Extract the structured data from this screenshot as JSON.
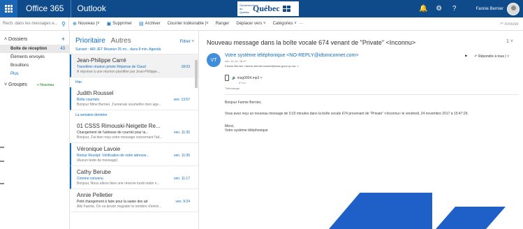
{
  "topbar": {
    "brand": "Office 365",
    "app": "Outlook",
    "gov_prefix": "Gouvernement du Québec",
    "gov_name": "Québec",
    "user_name": "Fannie Bernier"
  },
  "toolbar": {
    "search_placeholder": "Rech. dans les messages e...",
    "new": "Nouveau",
    "delete": "Supprimer",
    "archive": "Archiver",
    "junk": "Courrier indésirable",
    "sweep": "Ranger",
    "move": "Déplacer vers",
    "categories": "Catégories",
    "undo": "Annuler"
  },
  "folders": {
    "header": "Dossiers",
    "items": [
      {
        "label": "Boîte de réception",
        "count": "43"
      },
      {
        "label": "Éléments envoyés",
        "count": ""
      },
      {
        "label": "Brouillons",
        "count": ""
      },
      {
        "label": "Plus",
        "count": ""
      }
    ],
    "groups": "Groupes",
    "groups_new": "+ Nouveau"
  },
  "list": {
    "tab_focused": "Prioritaire",
    "tab_other": "Autres",
    "filter": "Filtrer",
    "tab_message": "Suivant : AIR JET Réunion 25 mi... dans 8 min. Agenda",
    "sections": {
      "yesterday": "Hier",
      "last_week": "La semaine dernière"
    },
    "messages": [
      {
        "sender": "Jean-Philippe Carré",
        "subject": "Transférer réunion privée Réponse de Claud",
        "time": "18:03",
        "preview": "À réponse à une réunion planifiée par Jean-Philippe..."
      },
      {
        "sender": "Judith Roussel",
        "subject": "Boîte courriels",
        "time": "ven. 13:57",
        "preview": "Bonjour Mme Bernier, J'annerais soumettre mon age..."
      },
      {
        "sender": "01 CSSS Rimouski-Neigette Re...",
        "subject": "Changement de l'adresse de courriel pour la...",
        "time": "ven. 11:35",
        "preview": "Bonjour, J'ai bien reçu votre message concernant l'ad..."
      },
      {
        "sender": "Véronique Lavoie",
        "subject": "Retour Receipt: Vérification de votre adresse...",
        "time": "ven. 11:35",
        "preview": "(Aucun texte de message)"
      },
      {
        "sender": "Cathy Berube",
        "subject": "Comme convenu",
        "time": "ven. 11:17",
        "preview": "Bonjour, Nous allons faire une réserve lundi matin s..."
      },
      {
        "sender": "Annie Pelletier",
        "subject": "Petit changement à faire pour la saisie des ad",
        "time": "ven. 9:24",
        "preview": "Allo Fannie, On va devoir réajuster le nombre d'entré..."
      }
    ]
  },
  "reading": {
    "title": "Nouveau message dans la boîte vocale 674 venant de \"Private\" <Inconnu>",
    "title_ctrl": "1",
    "avatar": "VT",
    "from": "Votre système téléphonique <NO-REPLY@idsmiconnet.com>",
    "date": "ven. 11-24, 15:47",
    "to": "Fannie Bernier <fannie.bernier.csssrbt@ssss.gouv.qc.ca>",
    "reply_all": "Répondre à tous",
    "attachment_name": "msg0004.mp3",
    "attachment_size": "87 ko",
    "download": "Télécharger",
    "greeting": "Bonjour Fannie Bernier,",
    "body": "Vous avez reçu un nouveau message de 0:23 minutes dans la boîte vocale 674 provenant de \"Private\" <Inconnu> le vendredi, 24 novembre 2017 à 15:47:29.",
    "thanks": "Merci,",
    "signature": "Votre système téléphonique"
  },
  "colors": {
    "topbar": "#0f4a8a",
    "accent": "#0f6cbd",
    "shape": "#1f5fc8"
  }
}
